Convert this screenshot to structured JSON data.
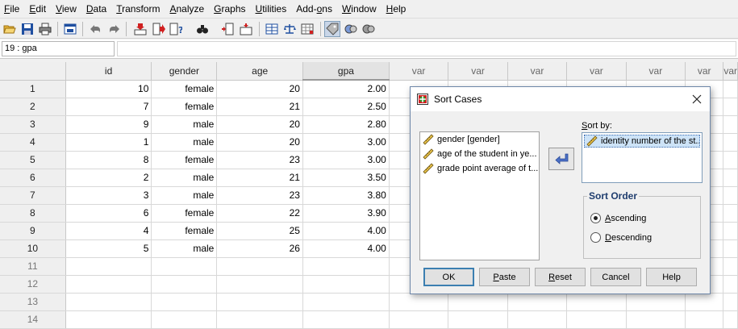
{
  "menu": {
    "items": [
      {
        "label": "File",
        "key": "F",
        "rest": "ile"
      },
      {
        "label": "Edit",
        "key": "E",
        "rest": "dit"
      },
      {
        "label": "View",
        "key": "V",
        "rest": "iew"
      },
      {
        "label": "Data",
        "key": "D",
        "rest": "ata"
      },
      {
        "label": "Transform",
        "key": "T",
        "rest": "ransform"
      },
      {
        "label": "Analyze",
        "key": "A",
        "rest": "nalyze"
      },
      {
        "label": "Graphs",
        "key": "G",
        "rest": "raphs"
      },
      {
        "label": "Utilities",
        "key": "U",
        "rest": "tilities"
      },
      {
        "label": "Add-ons",
        "pre": "Add-",
        "key": "o",
        "rest": "ns"
      },
      {
        "label": "Window",
        "key": "W",
        "rest": "indow"
      },
      {
        "label": "Help",
        "key": "H",
        "rest": "elp"
      }
    ]
  },
  "toolbar": {
    "icons": [
      "open-folder-icon",
      "save-icon",
      "print-icon",
      "dialog-recall-icon",
      "undo-icon",
      "redo-icon",
      "goto-case-icon",
      "goto-variable-icon",
      "variables-icon",
      "find-icon",
      "insert-cases-icon",
      "insert-variable-icon",
      "split-file-icon",
      "weight-cases-icon",
      "select-cases-icon",
      "value-labels-icon",
      "use-sets-icon",
      "show-sets-icon"
    ]
  },
  "cellbar": {
    "ref": "19 : gpa",
    "value": ""
  },
  "grid": {
    "columns": [
      "id",
      "gender",
      "age",
      "gpa",
      "var",
      "var",
      "var",
      "var",
      "var",
      "var"
    ],
    "row_numbers": [
      "1",
      "2",
      "3",
      "4",
      "5",
      "6",
      "7",
      "8",
      "9",
      "10",
      "11",
      "12",
      "13",
      "14"
    ],
    "rows": [
      [
        "10",
        "female",
        "20",
        "2.00"
      ],
      [
        "7",
        "female",
        "21",
        "2.50"
      ],
      [
        "9",
        "male",
        "20",
        "2.80"
      ],
      [
        "1",
        "male",
        "20",
        "3.00"
      ],
      [
        "8",
        "female",
        "23",
        "3.00"
      ],
      [
        "2",
        "male",
        "21",
        "3.50"
      ],
      [
        "3",
        "male",
        "23",
        "3.80"
      ],
      [
        "6",
        "female",
        "22",
        "3.90"
      ],
      [
        "4",
        "female",
        "25",
        "4.00"
      ],
      [
        "5",
        "male",
        "26",
        "4.00"
      ]
    ]
  },
  "dialog": {
    "title": "Sort Cases",
    "variables": [
      {
        "label": "gender  [gender]",
        "icon": "ruler-scale-icon"
      },
      {
        "label": "age of the student in ye...",
        "icon": "ruler-scale-icon"
      },
      {
        "label": "grade point average of t...",
        "icon": "ruler-scale-icon"
      }
    ],
    "sort_by_label_key": "S",
    "sort_by_label_rest": "ort by:",
    "sort_by_items": [
      {
        "label": "identity number of the st...",
        "icon": "ruler-scale-icon"
      }
    ],
    "sort_order": {
      "title": "Sort Order",
      "options": [
        {
          "key": "A",
          "rest": "scending",
          "label": "Ascending",
          "selected": true
        },
        {
          "key": "D",
          "rest": "escending",
          "label": "Descending",
          "selected": false
        }
      ]
    },
    "buttons": {
      "ok": "OK",
      "paste_key": "P",
      "paste_rest": "aste",
      "reset_key": "R",
      "reset_rest": "eset",
      "cancel": "Cancel",
      "help": "Help"
    }
  },
  "colors": {
    "accent": "#3c7fb1",
    "selection": "#cde3f7",
    "group_title": "#1f3d6e"
  }
}
